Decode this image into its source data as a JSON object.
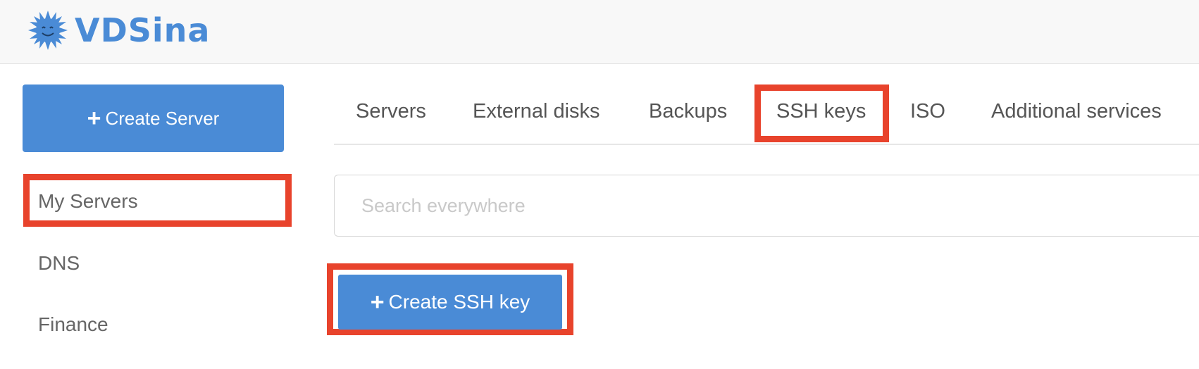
{
  "brand": {
    "name": "VDSina",
    "icon": "sun-mascot-icon",
    "color": "#4a8bd6"
  },
  "sidebar": {
    "create_button": {
      "icon": "plus-icon",
      "label": "Create Server"
    },
    "items": [
      {
        "label": "My Servers",
        "highlighted": true
      },
      {
        "label": "DNS",
        "highlighted": false
      },
      {
        "label": "Finance",
        "highlighted": false
      }
    ]
  },
  "tabs": [
    {
      "label": "Servers"
    },
    {
      "label": "External disks"
    },
    {
      "label": "Backups"
    },
    {
      "label": "SSH keys",
      "highlighted": true
    },
    {
      "label": "ISO"
    },
    {
      "label": "Additional services"
    }
  ],
  "search": {
    "placeholder": "Search everywhere",
    "value": ""
  },
  "actions": {
    "create_ssh": {
      "icon": "plus-icon",
      "label": "Create SSH key"
    }
  },
  "colors": {
    "accent": "#4a8bd6",
    "highlight": "#e8432c",
    "text": "#555555"
  }
}
